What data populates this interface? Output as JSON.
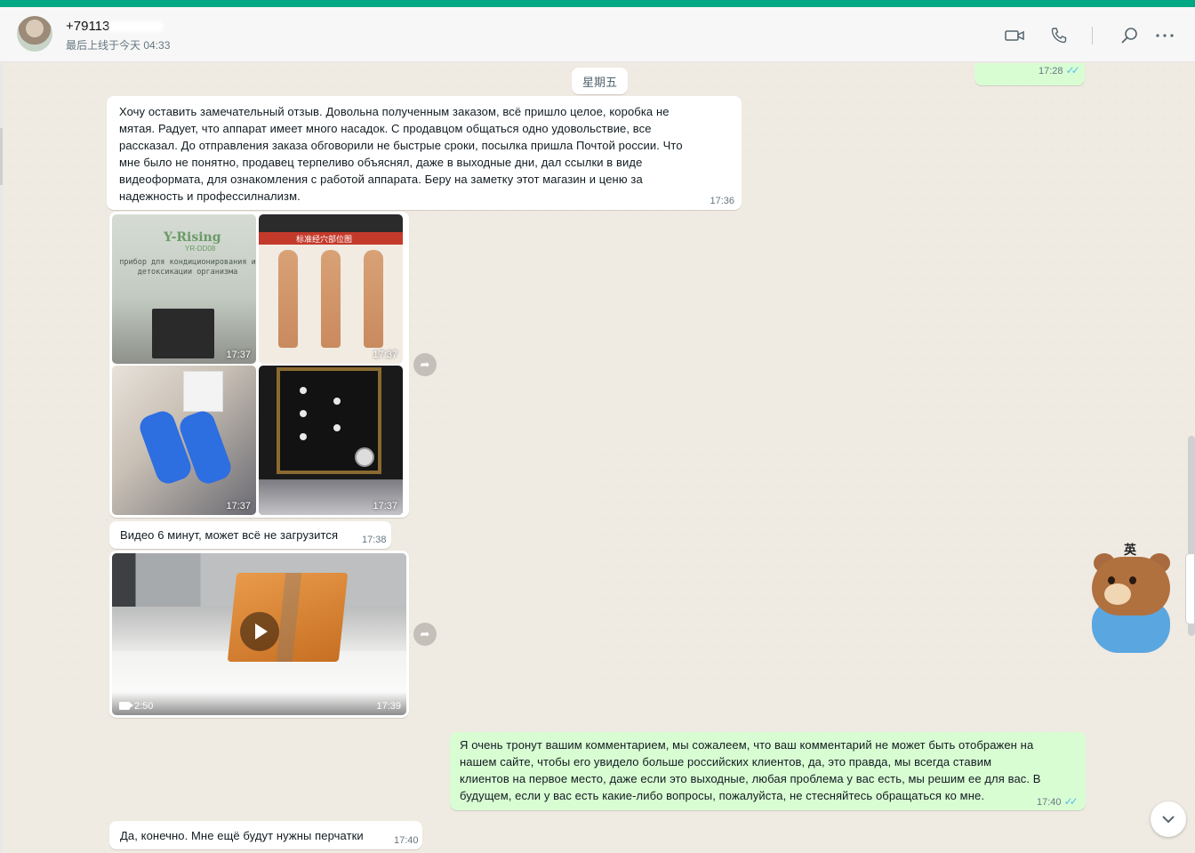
{
  "header": {
    "contact_name": "+79113",
    "last_seen": "最后上线于今天 04:33",
    "icons": [
      "video-call-icon",
      "voice-call-icon",
      "search-icon",
      "more-icon"
    ]
  },
  "chat": {
    "date_separator": "星期五",
    "messages": [
      {
        "direction": "out",
        "type": "sticker",
        "time": "17:28",
        "status": "read"
      },
      {
        "direction": "in",
        "type": "text",
        "lines": [
          "Хочу оставить замечательный отзыв. Довольна полученным заказом, всё пришло целое,  коробка не",
          "мятая. Радует, что аппарат имеет много насадок. С продавцом общаться одно удовольствие, все",
          "рассказал. До отправления заказа обговорили не быстрые сроки, посылка пришла Почтой россии. Что",
          "мне было не понятно,  продавец терпеливо объяснял,  даже в выходные дни, дал ссылки в виде",
          "видеоформата, для ознакомления с работой аппарата. Беру на заметку этот магазин и ценю за",
          "надежность и профессилнализм."
        ],
        "time": "17:36"
      },
      {
        "direction": "in",
        "type": "album",
        "photos": [
          {
            "time": "17:37",
            "brand_text": "Y-Rising",
            "model_text": "YR-DD08",
            "caption_text": "прибор для кондиционирования и детоксикации организма"
          },
          {
            "time": "17:37",
            "poster_text": "标准经穴部位图"
          },
          {
            "time": "17:37"
          },
          {
            "time": "17:37"
          }
        ]
      },
      {
        "direction": "in",
        "type": "text",
        "text": "Видео 6 минут, может всё  не загрузится",
        "time": "17:38"
      },
      {
        "direction": "in",
        "type": "video",
        "duration": "2:50",
        "time": "17:39"
      },
      {
        "direction": "out",
        "type": "text",
        "lines": [
          "Я очень тронут вашим комментарием, мы сожалеем, что ваш комментарий не может быть отображен на",
          "нашем сайте, чтобы его увидело больше российских клиентов, да, это правда, мы всегда ставим",
          "клиентов на первое место, даже если это выходные, любая проблема у вас есть, мы решим ее для вас. В",
          "будущем, если у вас есть какие-либо вопросы, пожалуйста, не стесняйтесь обращаться ко мне."
        ],
        "time": "17:40",
        "status": "read"
      },
      {
        "direction": "in",
        "type": "text",
        "text": "Да, конечно. Мне  ещё будут нужны перчатки",
        "time": "17:40"
      }
    ]
  },
  "overlay": {
    "mascot_badge": "英",
    "scroll_down_icon": "chevron-down-icon"
  },
  "colors": {
    "accent": "#00a884",
    "incoming_bubble": "#ffffff",
    "outgoing_bubble": "#d9fdd3",
    "read_ticks": "#53bdeb",
    "chat_background": "#efeae2"
  }
}
